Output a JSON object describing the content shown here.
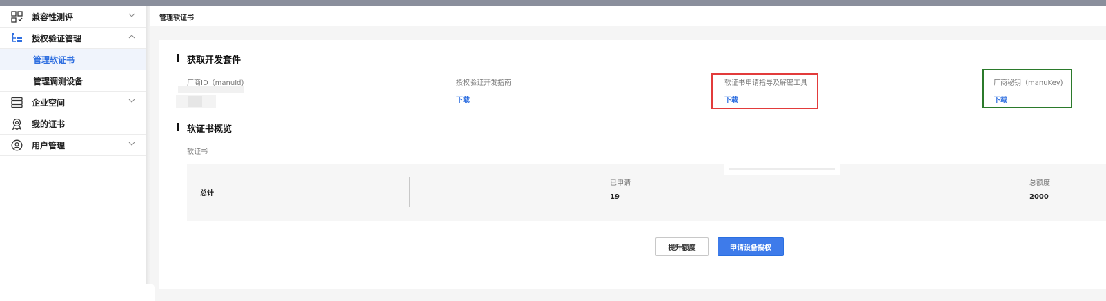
{
  "sidebar": {
    "items": [
      {
        "label": "兼容性测评",
        "icon": "compatibility-icon"
      },
      {
        "label": "授权验证管理",
        "icon": "auth-tree-icon"
      },
      {
        "label": "管理软证书"
      },
      {
        "label": "管理调测设备"
      },
      {
        "label": "企业空间",
        "icon": "server-icon"
      },
      {
        "label": "我的证书",
        "icon": "certificate-icon"
      },
      {
        "label": "用户管理",
        "icon": "user-icon"
      }
    ],
    "active_color": "#2f6fe0"
  },
  "header": {
    "breadcrumb": "管理软证书"
  },
  "devkit": {
    "title": "获取开发套件",
    "manu_id_label": "厂商ID（manuId)",
    "guide_label": "授权验证开发指南",
    "guide_link": "下载",
    "tool_label": "软证书申请指导及解密工具",
    "tool_link": "下载",
    "key_label": "厂商秘钥（manuKey)",
    "key_link": "下载"
  },
  "overview": {
    "title": "软证书概览",
    "sub_label": "软证书",
    "total_label": "总计",
    "applied_label": "已申请",
    "applied_value": "19",
    "quota_label": "总额度",
    "quota_value": "2000"
  },
  "actions": {
    "raise_quota": "提升额度",
    "apply_device": "申请设备授权"
  },
  "highlight": {
    "red": "#e23b3b",
    "green": "#2b7a2b"
  }
}
